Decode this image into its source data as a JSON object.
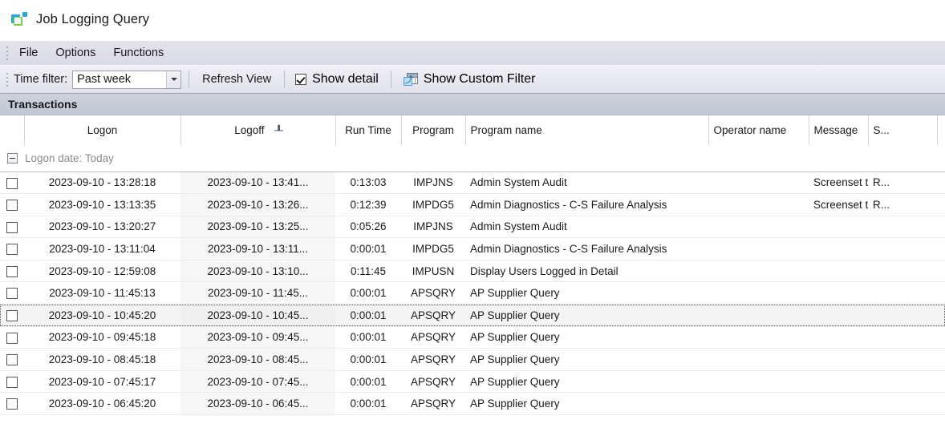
{
  "window": {
    "title": "Job Logging Query",
    "icon": "app-logo-icon"
  },
  "menubar": {
    "items": [
      {
        "label": "File"
      },
      {
        "label": "Options"
      },
      {
        "label": "Functions"
      }
    ]
  },
  "toolbar": {
    "time_filter_label": "Time filter:",
    "time_filter_value": "Past week",
    "time_filter_placeholder": "Past week",
    "refresh_label": "Refresh View",
    "show_detail_label": "Show detail",
    "show_detail_checked": true,
    "custom_filter_label": "Show Custom Filter",
    "custom_filter_icon": "table-filter-icon",
    "dropdown_icon": "chevron-down-icon"
  },
  "section": {
    "title": "Transactions"
  },
  "grid": {
    "columns": [
      {
        "key": "check",
        "label": "",
        "align": "center"
      },
      {
        "key": "logon",
        "label": "Logon",
        "align": "center"
      },
      {
        "key": "logoff",
        "label": "Logoff",
        "align": "center",
        "sorted": true,
        "sort_glyph": "┸"
      },
      {
        "key": "runtime",
        "label": "Run Time",
        "align": "center"
      },
      {
        "key": "program",
        "label": "Program",
        "align": "center"
      },
      {
        "key": "pname",
        "label": "Program name",
        "align": "left"
      },
      {
        "key": "opname",
        "label": "Operator name",
        "align": "left"
      },
      {
        "key": "message",
        "label": "Message",
        "align": "left"
      },
      {
        "key": "status",
        "label": "S...",
        "align": "left"
      },
      {
        "key": "extra",
        "label": "",
        "align": "left"
      }
    ],
    "group": {
      "label": "Logon date: Today",
      "expanded": true,
      "expander_icon": "collapse-minus-icon"
    },
    "rows": [
      {
        "checked": false,
        "focused": false,
        "logon": "2023-09-10 - 13:28:18",
        "logoff": "2023-09-10 - 13:41...",
        "runtime": "0:13:03",
        "program": "IMPJNS",
        "pname": "Admin System Audit",
        "opname": "",
        "message": "Screenset tra...",
        "status": "R..."
      },
      {
        "checked": false,
        "focused": false,
        "logon": "2023-09-10 - 13:13:35",
        "logoff": "2023-09-10 - 13:26...",
        "runtime": "0:12:39",
        "program": "IMPDG5",
        "pname": "Admin Diagnostics - C-S Failure Analysis",
        "opname": "",
        "message": "Screenset tra...",
        "status": "R..."
      },
      {
        "checked": false,
        "focused": false,
        "logon": "2023-09-10 - 13:20:27",
        "logoff": "2023-09-10 - 13:25...",
        "runtime": "0:05:26",
        "program": "IMPJNS",
        "pname": "Admin System Audit",
        "opname": "",
        "message": "",
        "status": ""
      },
      {
        "checked": false,
        "focused": false,
        "logon": "2023-09-10 - 13:11:04",
        "logoff": "2023-09-10 - 13:11...",
        "runtime": "0:00:01",
        "program": "IMPDG5",
        "pname": "Admin Diagnostics - C-S Failure Analysis",
        "opname": "",
        "message": "",
        "status": ""
      },
      {
        "checked": false,
        "focused": false,
        "logon": "2023-09-10 - 12:59:08",
        "logoff": "2023-09-10 - 13:10...",
        "runtime": "0:11:45",
        "program": "IMPUSN",
        "pname": "Display Users Logged in Detail",
        "opname": "",
        "message": "",
        "status": ""
      },
      {
        "checked": false,
        "focused": false,
        "logon": "2023-09-10 - 11:45:13",
        "logoff": "2023-09-10 - 11:45...",
        "runtime": "0:00:01",
        "program": "APSQRY",
        "pname": "AP Supplier Query",
        "opname": "",
        "message": "",
        "status": ""
      },
      {
        "checked": false,
        "focused": true,
        "logon": "2023-09-10 - 10:45:20",
        "logoff": "2023-09-10 - 10:45...",
        "runtime": "0:00:01",
        "program": "APSQRY",
        "pname": "AP Supplier Query",
        "opname": "",
        "message": "",
        "status": ""
      },
      {
        "checked": false,
        "focused": false,
        "logon": "2023-09-10 - 09:45:18",
        "logoff": "2023-09-10 - 09:45...",
        "runtime": "0:00:01",
        "program": "APSQRY",
        "pname": "AP Supplier Query",
        "opname": "",
        "message": "",
        "status": ""
      },
      {
        "checked": false,
        "focused": false,
        "logon": "2023-09-10 - 08:45:18",
        "logoff": "2023-09-10 - 08:45...",
        "runtime": "0:00:01",
        "program": "APSQRY",
        "pname": "AP Supplier Query",
        "opname": "",
        "message": "",
        "status": ""
      },
      {
        "checked": false,
        "focused": false,
        "logon": "2023-09-10 - 07:45:17",
        "logoff": "2023-09-10 - 07:45...",
        "runtime": "0:00:01",
        "program": "APSQRY",
        "pname": "AP Supplier Query",
        "opname": "",
        "message": "",
        "status": ""
      },
      {
        "checked": false,
        "focused": false,
        "logon": "2023-09-10 - 06:45:20",
        "logoff": "2023-09-10 - 06:45...",
        "runtime": "0:00:01",
        "program": "APSQRY",
        "pname": "AP Supplier Query",
        "opname": "",
        "message": "",
        "status": ""
      }
    ]
  },
  "colors": {
    "menubar_bg": "#dcdce6",
    "toolbar_bg": "#e7e7ef",
    "section_band_bg": "#c6ccd6",
    "sorted_column_bg": "#f6f6f6",
    "focus_row_bg": "#f4f4f4",
    "text": "#1a1a1a",
    "group_label": "#8a8a8a"
  }
}
